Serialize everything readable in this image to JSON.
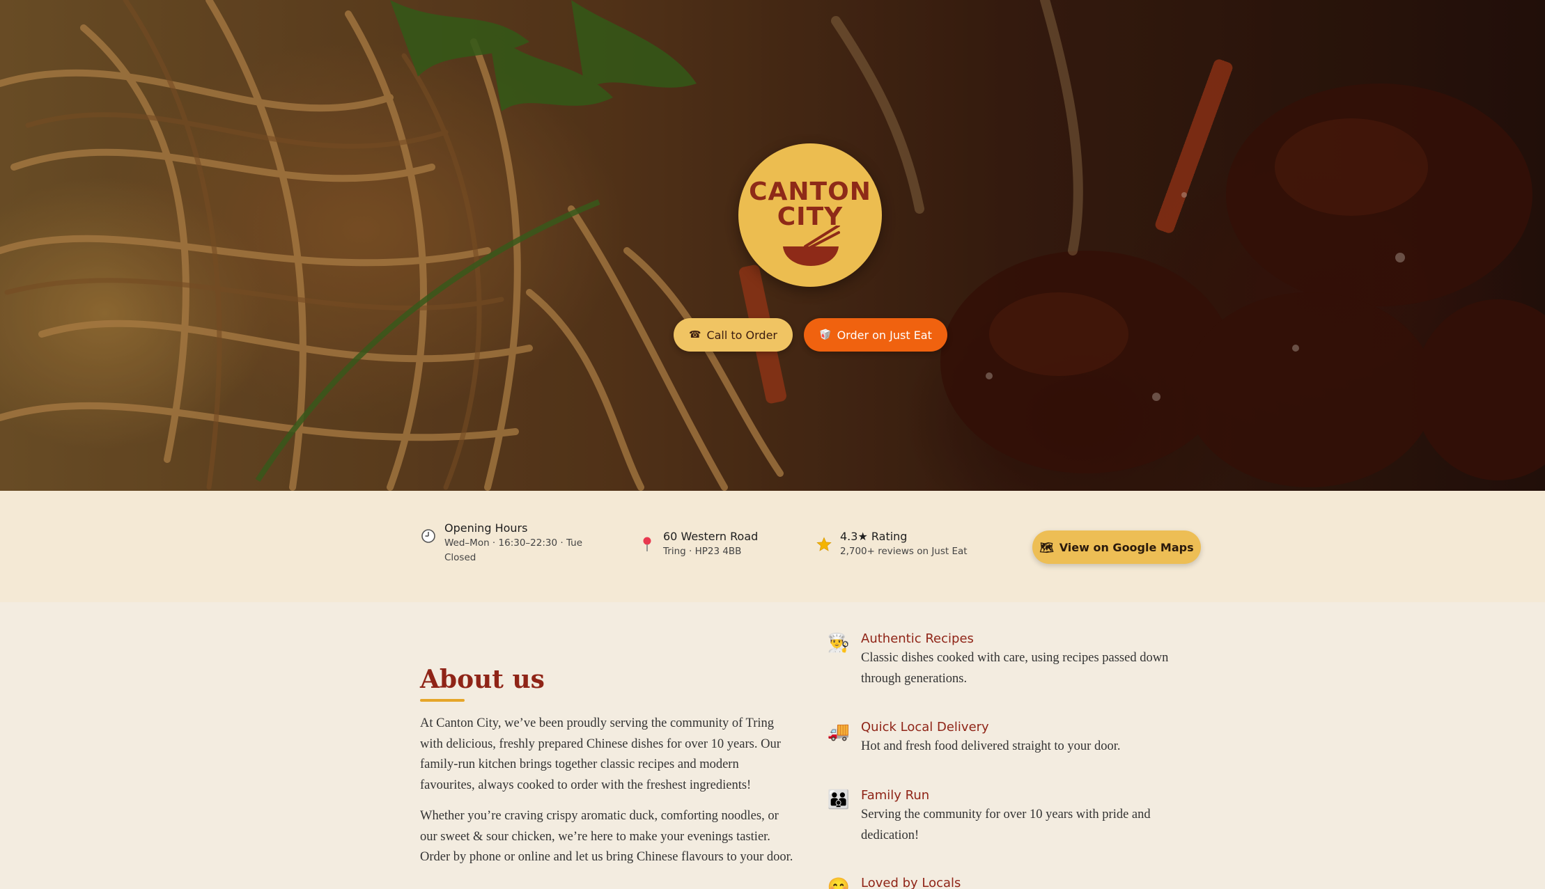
{
  "brand": {
    "logo_line1": "CANTON",
    "logo_line2": "CITY"
  },
  "hero": {
    "call_button": {
      "icon": "☎",
      "label": "Call to Order"
    },
    "order_button": {
      "icon": "🥡",
      "label": "Order on Just Eat"
    }
  },
  "info_bar": {
    "hours": {
      "icon": "clock-icon",
      "title": "Opening Hours",
      "detail": "Wed–Mon · 16:30–22:30 · Tue Closed"
    },
    "address": {
      "icon": "pin-icon",
      "title": "60 Western Road",
      "detail": "Tring · HP23 4BB"
    },
    "rating": {
      "icon": "star-icon",
      "title": "4.3★ Rating",
      "detail": "2,700+ reviews on Just Eat"
    },
    "maps_button": {
      "icon": "🗺",
      "label": "View on Google Maps"
    }
  },
  "about": {
    "heading": "About us",
    "paragraph1": "At Canton City, we’ve been proudly serving the community of Tring with delicious, freshly prepared Chinese dishes for over 10 years. Our family-run kitchen brings together classic recipes and modern favourites, always cooked to order with the freshest ingredients!",
    "paragraph2": "Whether you’re craving crispy aromatic duck, comforting noodles, or our sweet & sour chicken, we’re here to make your evenings tastier. Order by phone or online and let us bring Chinese flavours to your door."
  },
  "features": [
    {
      "icon": "👨‍🍳",
      "title": "Authentic Recipes",
      "text": "Classic dishes cooked with care, using recipes passed down through generations."
    },
    {
      "icon": "🚚",
      "title": "Quick Local Delivery",
      "text": "Hot and fresh food delivered straight to your door."
    },
    {
      "icon": "👪",
      "title": "Family Run",
      "text": "Serving the community for over 10 years with pride and dedication!"
    },
    {
      "icon": "😊",
      "title": "Loved by Locals",
      "text": ""
    }
  ],
  "colors": {
    "brand_red": "#8f2417",
    "gold": "#ecbd50",
    "orange": "#f0620f",
    "cream": "#f4e9d5"
  }
}
